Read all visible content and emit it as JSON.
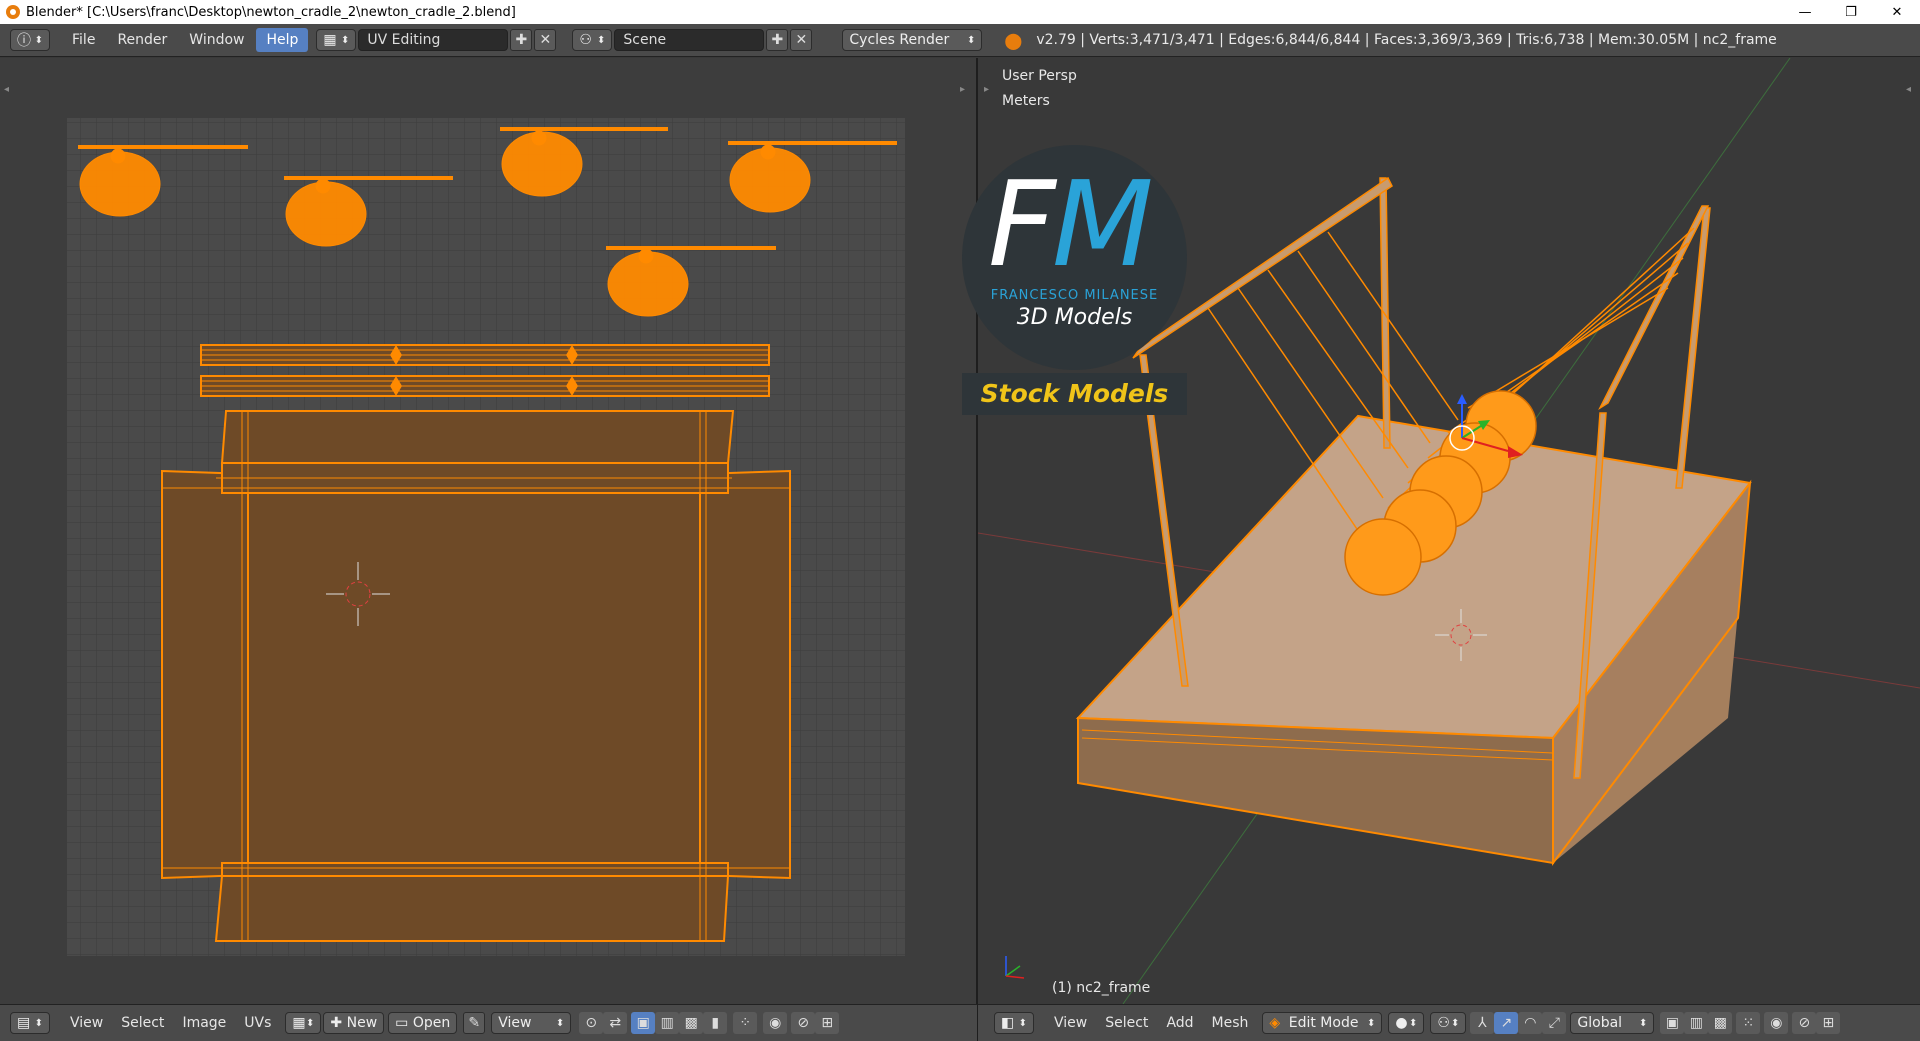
{
  "window": {
    "title": "Blender* [C:\\Users\\franc\\Desktop\\newton_cradle_2\\newton_cradle_2.blend]",
    "minimize": "—",
    "maximize": "❐",
    "close": "✕"
  },
  "info_header": {
    "menus": [
      "File",
      "Render",
      "Window",
      "Help"
    ],
    "active_menu": "Help",
    "screen_layout": "UV Editing",
    "scene": "Scene",
    "render_engine": "Cycles Render",
    "stats": "v2.79 | Verts:3,471/3,471 | Edges:6,844/6,844 | Faces:3,369/3,369 | Tris:6,738 | Mem:30.05M | nc2_frame"
  },
  "uv_editor": {
    "menus": [
      "View",
      "Select",
      "Image",
      "UVs"
    ],
    "new_label": "New",
    "open_label": "Open",
    "view_label": "View"
  },
  "viewport": {
    "view_name": "User Persp",
    "units": "Meters",
    "object_label": "(1) nc2_frame",
    "menus": [
      "View",
      "Select",
      "Add",
      "Mesh"
    ],
    "mode": "Edit Mode",
    "orientation": "Global"
  },
  "watermark": {
    "monogram_f": "F",
    "monogram_m": "M",
    "name": "FRANCESCO MILANESE",
    "subtitle": "3D Models",
    "banner": "Stock Models"
  },
  "colors": {
    "accent_orange": "#ff8a00",
    "selected_menu": "#5680c2",
    "logo_blue": "#2aa3d8",
    "logo_gold": "#f0c419"
  }
}
